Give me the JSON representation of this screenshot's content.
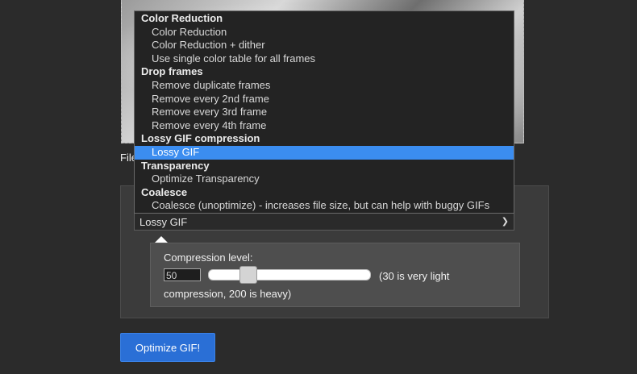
{
  "file_label": "File",
  "select": {
    "value": "Lossy GIF",
    "chevron_icon": "chevron-down-icon"
  },
  "dropdown": {
    "groups": [
      {
        "label": "Color Reduction",
        "options": [
          "Color Reduction",
          "Color Reduction + dither",
          "Use single color table for all frames"
        ]
      },
      {
        "label": "Drop frames",
        "options": [
          "Remove duplicate frames",
          "Remove every 2nd frame",
          "Remove every 3rd frame",
          "Remove every 4th frame"
        ]
      },
      {
        "label": "Lossy GIF compression",
        "options": [
          "Lossy GIF"
        ]
      },
      {
        "label": "Transparency",
        "options": [
          "Optimize Transparency"
        ]
      },
      {
        "label": "Coalesce",
        "options": [
          "Coalesce (unoptimize) - increases file size, but can help with buggy GIFs"
        ]
      }
    ],
    "selected": "Lossy GIF"
  },
  "compression": {
    "label": "Compression level:",
    "value": "50",
    "slider_fraction": 0.24,
    "hint": "(30 is very light compression, 200 is heavy)"
  },
  "optimize_button": "Optimize GIF!",
  "colors": {
    "accent": "#3b8df0",
    "button": "#2a6fd6"
  }
}
